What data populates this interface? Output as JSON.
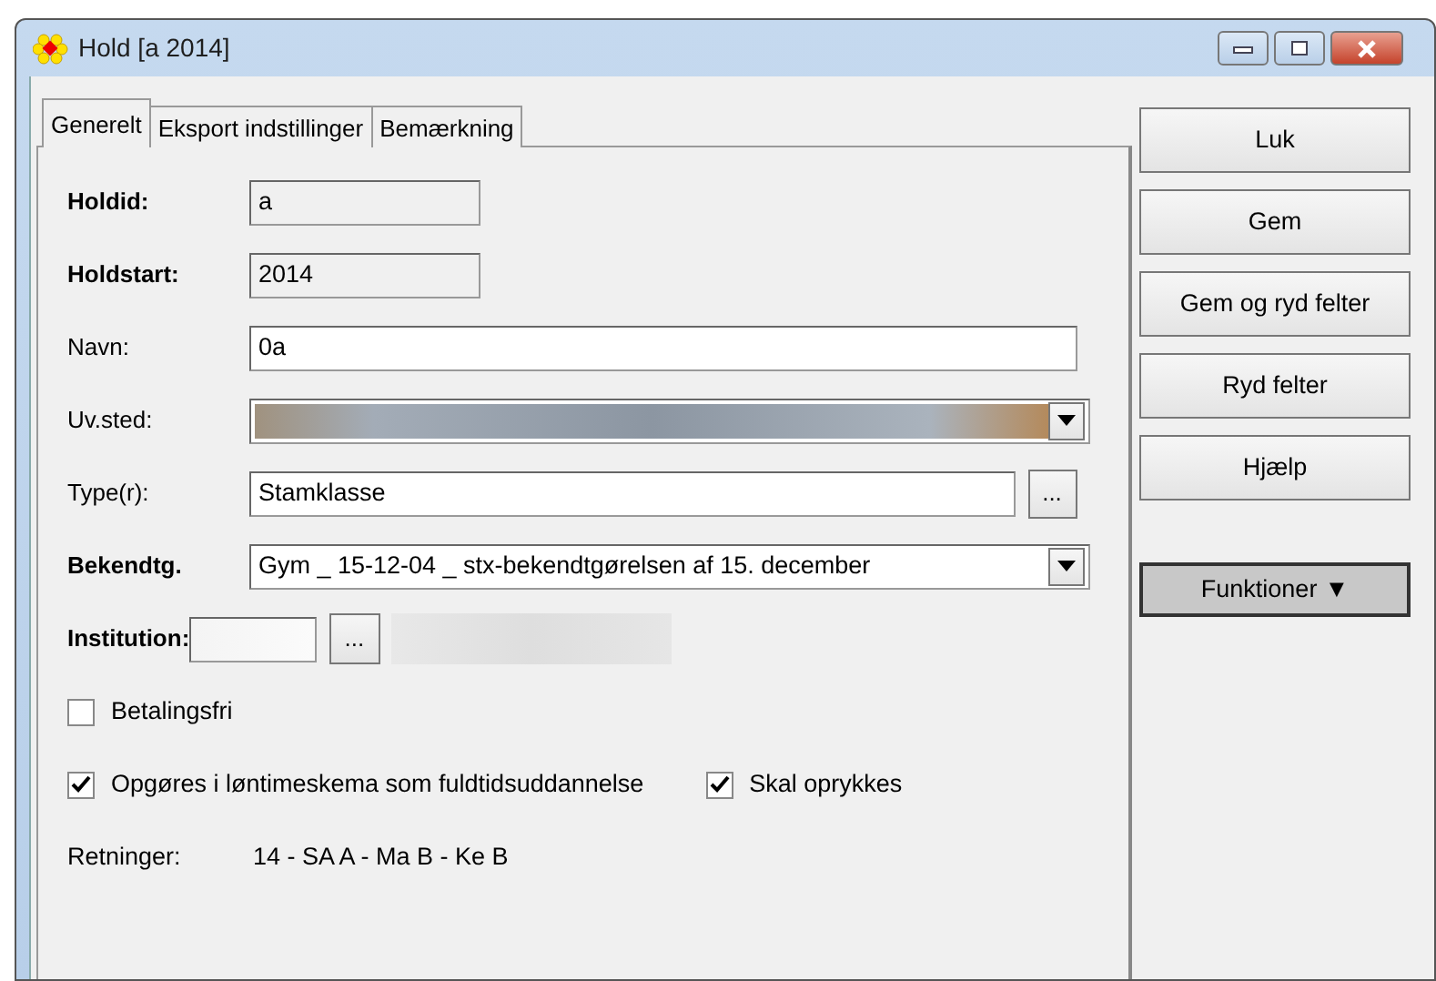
{
  "window": {
    "title": "Hold [a 2014]"
  },
  "tabs": [
    {
      "label": "Generelt",
      "selected": true
    },
    {
      "label": "Eksport indstillinger",
      "selected": false
    },
    {
      "label": "Bemærkning",
      "selected": false
    }
  ],
  "fields": [
    {
      "kind": "readonly",
      "label": "Holdid:",
      "bold": true,
      "value": "a"
    },
    {
      "kind": "readonly",
      "label": "Holdstart:",
      "bold": true,
      "value": "2014"
    },
    {
      "kind": "text",
      "label": "Navn:",
      "bold": false,
      "value": "0a"
    },
    {
      "kind": "blurcombo",
      "label": "Uv.sted:",
      "bold": false
    },
    {
      "kind": "browse",
      "label": "Type(r):",
      "bold": false,
      "value": "Stamklasse",
      "button": "..."
    },
    {
      "kind": "combo",
      "label": "Bekendtg.",
      "bold": true,
      "value": "Gym _ 15-12-04 _ stx-bekendtgørelsen af 15. december"
    },
    {
      "kind": "institution",
      "label": "Institution:",
      "bold": true,
      "button": "..."
    }
  ],
  "checks": [
    [
      {
        "label": "Betalingsfri",
        "checked": false
      }
    ],
    [
      {
        "label": "Opgøres i løntimeskema som fuldtidsuddannelse",
        "checked": true
      },
      {
        "label": "Skal oprykkes",
        "checked": true
      }
    ]
  ],
  "retninger": {
    "label": "Retninger:",
    "value": "14 - SA A - Ma B - Ke B"
  },
  "buttons": [
    {
      "label": "Luk"
    },
    {
      "label": "Gem"
    },
    {
      "label": "Gem og ryd felter"
    },
    {
      "label": "Ryd felter"
    },
    {
      "label": "Hjælp"
    }
  ],
  "menu_button": {
    "label": "Funktioner",
    "arrow": "▼"
  }
}
